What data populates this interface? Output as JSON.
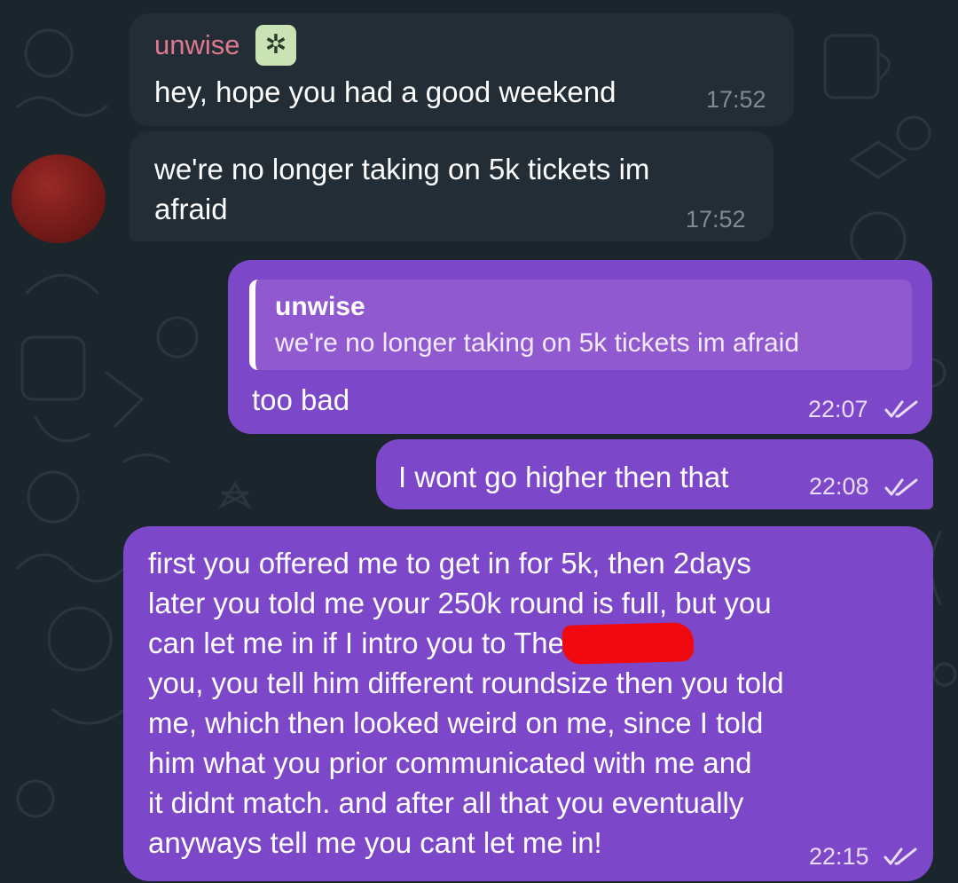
{
  "colors": {
    "background": "#1b262c",
    "incoming_bubble": "#222d35",
    "outgoing_bubble": "#7c47c9",
    "sender_name": "#e0788f",
    "redaction": "#f00a10"
  },
  "messages": [
    {
      "direction": "incoming",
      "sender": "unwise",
      "sender_badge_icon": "sparkle-badge-icon",
      "text": "hey, hope you had a good weekend",
      "time": "17:52"
    },
    {
      "direction": "incoming",
      "text": "we're no longer taking on 5k tickets im\nafraid",
      "time": "17:52",
      "avatar": "avatar"
    },
    {
      "direction": "outgoing",
      "reply_to": {
        "name": "unwise",
        "text": "we're no longer taking on 5k tickets im afraid"
      },
      "text": "too bad",
      "time": "22:07",
      "status_icon": "double-check-icon"
    },
    {
      "direction": "outgoing",
      "text": "I wont go higher then that",
      "time": "22:08",
      "status_icon": "double-check-icon"
    },
    {
      "direction": "outgoing",
      "text": "first you offered me to get in for 5k, then 2days\nlater you told me your 250k round is full, but you\ncan let me in if I intro you to            Then I intro\nyou, you tell him different roundsize then you told\nme, which then looked weird on me, since I told\nhim what you prior communicated with me and\nit didnt match. and after all that you eventually\nanyways tell me you cant let me in!",
      "time": "22:15",
      "status_icon": "double-check-icon",
      "redacted": true
    }
  ]
}
